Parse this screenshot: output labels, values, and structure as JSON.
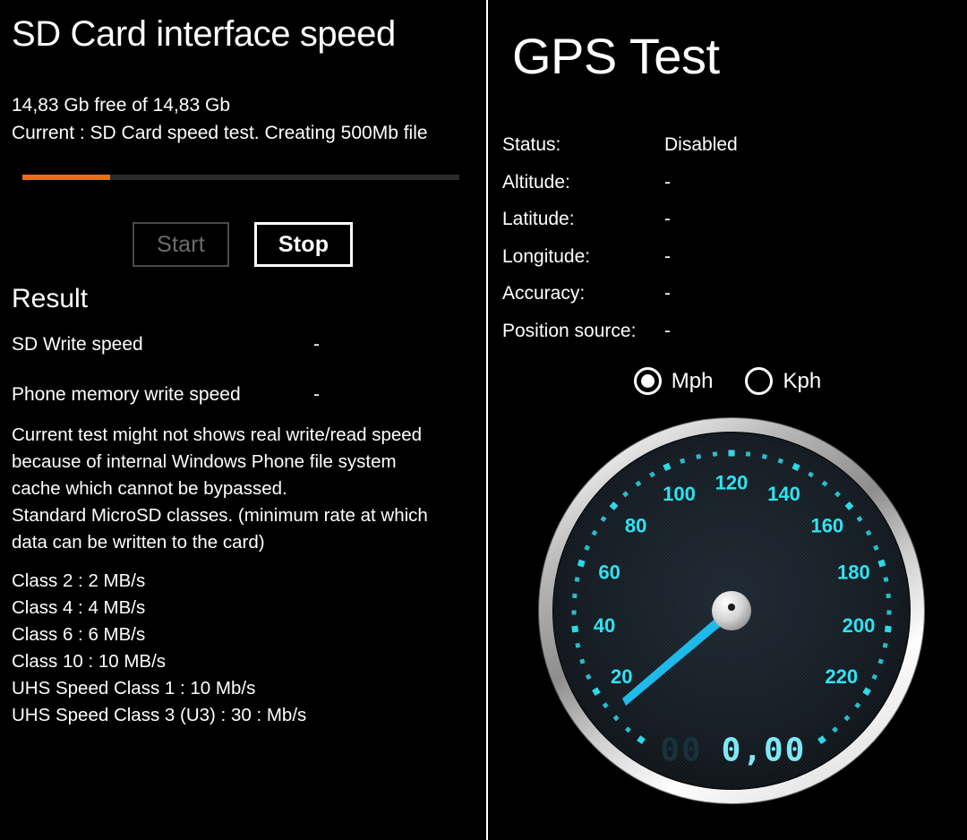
{
  "sd_panel": {
    "title": "SD Card interface speed",
    "storage_line": "14,83 Gb free of 14,83 Gb",
    "current_line": "Current : SD Card speed test. Creating 500Mb file",
    "progress_percent": 20,
    "progress_fill_color": "#ef6c16",
    "progress_track_color": "#2b2b2b",
    "buttons": {
      "start_label": "Start",
      "start_enabled": false,
      "stop_label": "Stop",
      "stop_enabled": true
    },
    "result_heading": "Result",
    "results": [
      {
        "label": "SD Write speed",
        "value": "-"
      },
      {
        "label": "Phone memory write speed",
        "value": "-"
      }
    ],
    "note_lines": [
      "Current test might not shows real write/read speed",
      "because of internal Windows Phone file system",
      "cache which cannot be bypassed.",
      "Standard MicroSD classes. (minimum rate at which",
      "data can be written to the card)"
    ],
    "classes": [
      "Class 2 : 2 MB/s",
      "Class 4 : 4 MB/s",
      "Class 6 : 6 MB/s",
      "Class 10 : 10 MB/s",
      "UHS Speed Class 1 : 10 Mb/s",
      "UHS Speed Class 3 (U3) : 30 : Mb/s"
    ]
  },
  "gps_panel": {
    "title": "GPS Test",
    "rows": [
      {
        "label": "Status:",
        "value": "Disabled"
      },
      {
        "label": "Altitude:",
        "value": "-"
      },
      {
        "label": "Latitude:",
        "value": "-"
      },
      {
        "label": "Longitude:",
        "value": "-"
      },
      {
        "label": "Accuracy:",
        "value": "-"
      },
      {
        "label": "Position source:",
        "value": "-"
      }
    ],
    "units": {
      "mph_label": "Mph",
      "kph_label": "Kph",
      "selected": "Mph"
    },
    "speedometer": {
      "tick_labels": [
        "20",
        "40",
        "60",
        "80",
        "100",
        "120",
        "140",
        "160",
        "180",
        "200",
        "220"
      ],
      "min": 0,
      "max": 240,
      "needle_value": 0,
      "digital_readout_dim": "00",
      "digital_readout_bright": "0,00",
      "dial_color": "#2fe3f2",
      "needle_color": "#19b8ea",
      "bezel_color": "#f0f0f0"
    }
  }
}
